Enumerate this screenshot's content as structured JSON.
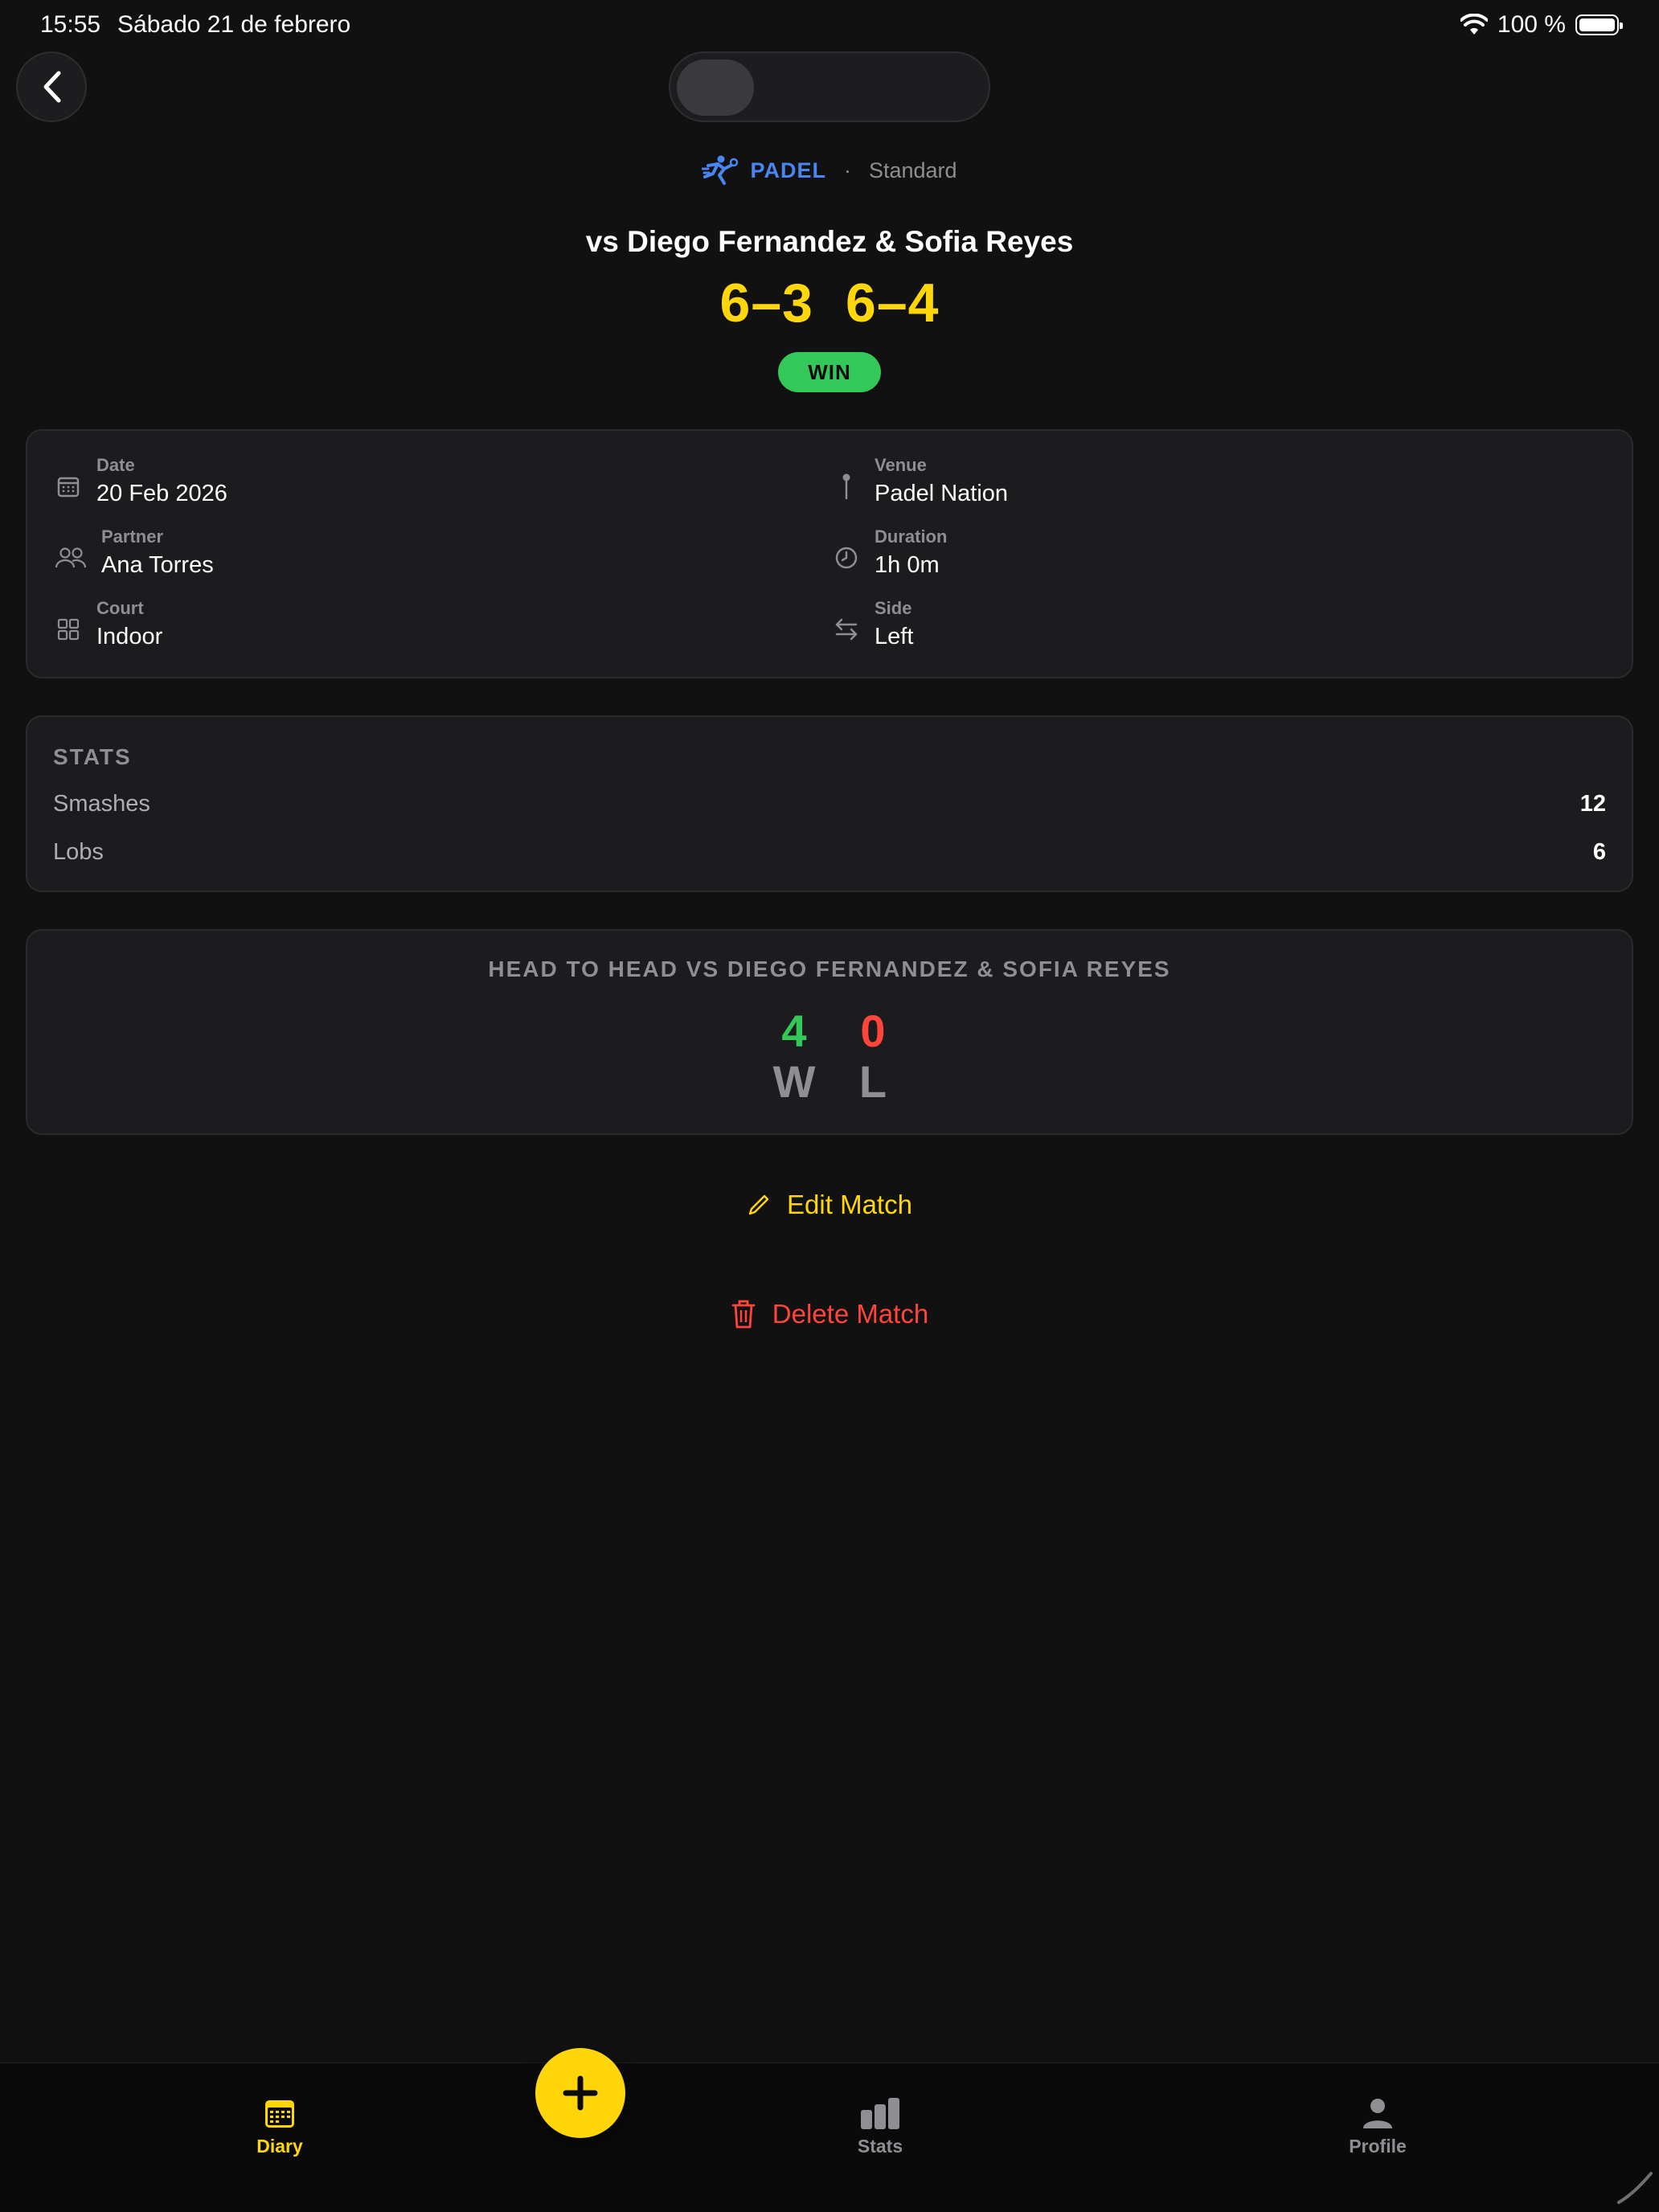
{
  "status_bar": {
    "time": "15:55",
    "date": "Sábado 21 de febrero",
    "battery": "100 %"
  },
  "match": {
    "sport": "PADEL",
    "separator": "·",
    "format": "Standard",
    "opponent_title": "vs Diego Fernandez & Sofia Reyes",
    "sets": [
      "6–3",
      "6–4"
    ],
    "result": "WIN"
  },
  "details": {
    "date": {
      "label": "Date",
      "value": "20 Feb 2026"
    },
    "venue": {
      "label": "Venue",
      "value": "Padel Nation"
    },
    "partner": {
      "label": "Partner",
      "value": "Ana Torres"
    },
    "duration": {
      "label": "Duration",
      "value": "1h 0m"
    },
    "court": {
      "label": "Court",
      "value": "Indoor"
    },
    "side": {
      "label": "Side",
      "value": "Left"
    }
  },
  "stats": {
    "heading": "STATS",
    "rows": [
      {
        "label": "Smashes",
        "value": "12"
      },
      {
        "label": "Lobs",
        "value": "6"
      }
    ]
  },
  "head_to_head": {
    "heading": "HEAD TO HEAD VS DIEGO FERNANDEZ & SOFIA REYES",
    "wins": "4",
    "losses": "0",
    "wins_label": "W",
    "losses_label": "L"
  },
  "actions": {
    "edit_label": "Edit Match",
    "delete_label": "Delete Match"
  },
  "tab_bar": {
    "diary": "Diary",
    "stats": "Stats",
    "profile": "Profile"
  },
  "colors": {
    "accent": "#ffd60a",
    "win": "#34c759",
    "loss": "#ff453a",
    "sport": "#4a86f0",
    "background": "#111112",
    "card": "#1c1c1e"
  }
}
